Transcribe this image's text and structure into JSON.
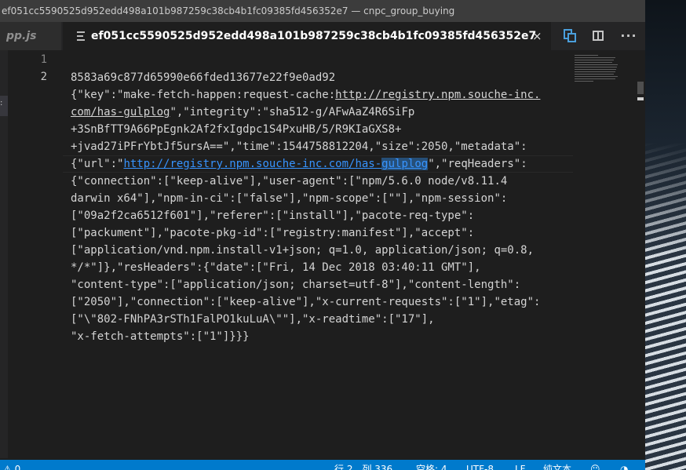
{
  "window": {
    "title": "ef051cc5590525d952edd498a101b987259c38cb4b1fc09385fd456352e7 — cnpc_group_buying"
  },
  "tabs": [
    {
      "label": "pp.js",
      "active": false
    },
    {
      "label": "ef051cc5590525d952edd498a101b987259c38cb4b1fc09385fd456352e7",
      "active": true,
      "close": "×"
    }
  ],
  "toolbar": {
    "compare_icon": "open-changes-icon",
    "split_icon": "split-editor-icon",
    "more_label": "···"
  },
  "sidebar": {
    "dots": ":"
  },
  "editor": {
    "line_numbers": [
      "1",
      "2"
    ],
    "lines": {
      "l1": "8583a69c877d65990e66fded13677e22f9e0ad92",
      "l2a": "{\"key\":\"make-fetch-happen:request-cache:",
      "l2a_link": "http://registry.npm.souche-inc.",
      "l2b_link": "com/has-gulplog",
      "l2b": "\",\"integrity\":\"sha512-g/AFwAaZ4R6SiFp",
      "l2c": "+3SnBfTT9A66PpEgnk2Af2fxIgdpc1S4PxuHB/5/R9KIaGXS8+",
      "l2d": "+jvad27iPFrYbtJf5ursA==\",\"time\":1544758812204,\"size\":2050,\"metadata\":",
      "l2e_pre": "{\"url\":\"",
      "l2e_link_a": "http://registry.npm.souche-inc.com/has-",
      "l2e_link_b": "gulplog",
      "l2e_post": "\",\"reqHeaders\":",
      "l2f": "{\"connection\":[\"keep-alive\"],\"user-agent\":[\"npm/5.6.0 node/v8.11.4",
      "l2g": "darwin x64\"],\"npm-in-ci\":[\"false\"],\"npm-scope\":[\"\"],\"npm-session\":",
      "l2h": "[\"09a2f2ca6512f601\"],\"referer\":[\"install\"],\"pacote-req-type\":",
      "l2i": "[\"packument\"],\"pacote-pkg-id\":[\"registry:manifest\"],\"accept\":",
      "l2j": "[\"application/vnd.npm.install-v1+json; q=1.0, application/json; q=0.8,",
      "l2k": "*/*\"]},\"resHeaders\":{\"date\":[\"Fri, 14 Dec 2018 03:40:11 GMT\"],",
      "l2l": "\"content-type\":[\"application/json; charset=utf-8\"],\"content-length\":",
      "l2m": "[\"2050\"],\"connection\":[\"keep-alive\"],\"x-current-requests\":[\"1\"],\"etag\":",
      "l2n": "[\"\\\"802-FNhPA3rSTh1FalPO1kuLuA\\\"\"],\"x-readtime\":[\"17\"],",
      "l2o": "\"x-fetch-attempts\":[\"1\"]}}}"
    }
  },
  "statusbar": {
    "left": "⚠ 0",
    "line": "行 2，列 336",
    "spaces": "空格: 4",
    "encoding": "UTF-8",
    "eol": "LF",
    "language": "纯文本",
    "feedback_icon": "smiley-icon",
    "bell_icon": "bell-icon"
  },
  "colors": {
    "titlebar": "#3c3c3c",
    "editor_bg": "#1e1e1e",
    "statusbar": "#007acc",
    "link": "#3794ff"
  }
}
